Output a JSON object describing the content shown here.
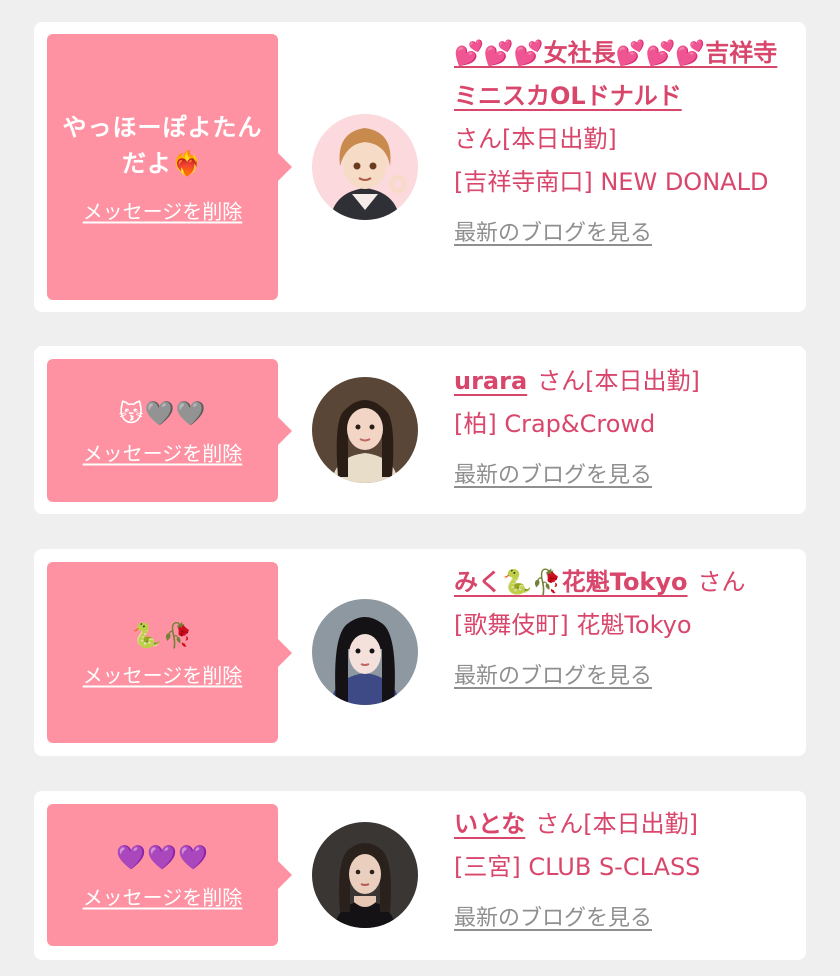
{
  "colors": {
    "background": "#efeff0",
    "card": "#ffffff",
    "bubble": "#fe92a2",
    "accent": "#d9466b",
    "muted": "#8f8f8f"
  },
  "messages": [
    {
      "message_text": "やっほーぽよたんだよ",
      "message_emoji": "❤️‍🔥",
      "delete_label": "メッセージを削除",
      "cast_name": "💕💕💕女社長💕💕💕吉祥寺ミニスカOLドナルド",
      "san": "さん",
      "status": "[本日出勤]",
      "shop": "[吉祥寺南口] NEW DONALD",
      "blog_label": "最新のブログを見る",
      "avatar_icon": "anime-girl-avatar"
    },
    {
      "message_text": "",
      "message_emoji": "😽🩶🩶",
      "delete_label": "メッセージを削除",
      "cast_name": "urara",
      "san": "さん",
      "status": "[本日出勤]",
      "shop": "[柏] Crap&Crowd",
      "blog_label": "最新のブログを見る",
      "avatar_icon": "girl-photo-avatar"
    },
    {
      "message_text": "",
      "message_emoji": "🐍🥀",
      "delete_label": "メッセージを削除",
      "cast_name": "みく🐍🥀花魁Tokyo",
      "san": "さん",
      "status": "",
      "shop": "[歌舞伎町] 花魁Tokyo",
      "blog_label": "最新のブログを見る",
      "avatar_icon": "girl-photo-avatar"
    },
    {
      "message_text": "",
      "message_emoji": "💜💜💜",
      "delete_label": "メッセージを削除",
      "cast_name": "いとな",
      "san": "さん",
      "status": "[本日出勤]",
      "shop": "[三宮] CLUB S-CLASS",
      "blog_label": "最新のブログを見る",
      "avatar_icon": "girl-photo-avatar"
    }
  ]
}
